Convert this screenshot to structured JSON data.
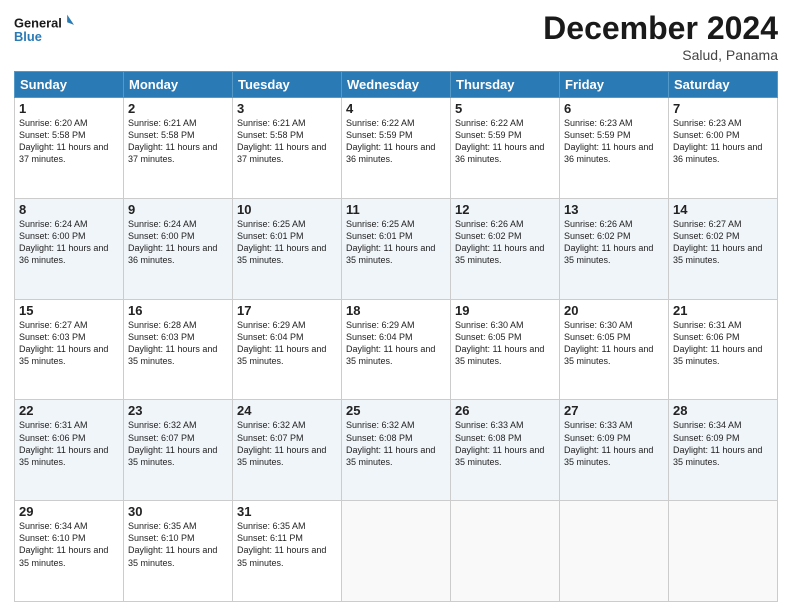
{
  "header": {
    "logo_line1": "General",
    "logo_line2": "Blue",
    "month": "December 2024",
    "location": "Salud, Panama"
  },
  "days_of_week": [
    "Sunday",
    "Monday",
    "Tuesday",
    "Wednesday",
    "Thursday",
    "Friday",
    "Saturday"
  ],
  "weeks": [
    [
      {
        "day": "1",
        "sunrise": "Sunrise: 6:20 AM",
        "sunset": "Sunset: 5:58 PM",
        "daylight": "Daylight: 11 hours and 37 minutes."
      },
      {
        "day": "2",
        "sunrise": "Sunrise: 6:21 AM",
        "sunset": "Sunset: 5:58 PM",
        "daylight": "Daylight: 11 hours and 37 minutes."
      },
      {
        "day": "3",
        "sunrise": "Sunrise: 6:21 AM",
        "sunset": "Sunset: 5:58 PM",
        "daylight": "Daylight: 11 hours and 37 minutes."
      },
      {
        "day": "4",
        "sunrise": "Sunrise: 6:22 AM",
        "sunset": "Sunset: 5:59 PM",
        "daylight": "Daylight: 11 hours and 36 minutes."
      },
      {
        "day": "5",
        "sunrise": "Sunrise: 6:22 AM",
        "sunset": "Sunset: 5:59 PM",
        "daylight": "Daylight: 11 hours and 36 minutes."
      },
      {
        "day": "6",
        "sunrise": "Sunrise: 6:23 AM",
        "sunset": "Sunset: 5:59 PM",
        "daylight": "Daylight: 11 hours and 36 minutes."
      },
      {
        "day": "7",
        "sunrise": "Sunrise: 6:23 AM",
        "sunset": "Sunset: 6:00 PM",
        "daylight": "Daylight: 11 hours and 36 minutes."
      }
    ],
    [
      {
        "day": "8",
        "sunrise": "Sunrise: 6:24 AM",
        "sunset": "Sunset: 6:00 PM",
        "daylight": "Daylight: 11 hours and 36 minutes."
      },
      {
        "day": "9",
        "sunrise": "Sunrise: 6:24 AM",
        "sunset": "Sunset: 6:00 PM",
        "daylight": "Daylight: 11 hours and 36 minutes."
      },
      {
        "day": "10",
        "sunrise": "Sunrise: 6:25 AM",
        "sunset": "Sunset: 6:01 PM",
        "daylight": "Daylight: 11 hours and 35 minutes."
      },
      {
        "day": "11",
        "sunrise": "Sunrise: 6:25 AM",
        "sunset": "Sunset: 6:01 PM",
        "daylight": "Daylight: 11 hours and 35 minutes."
      },
      {
        "day": "12",
        "sunrise": "Sunrise: 6:26 AM",
        "sunset": "Sunset: 6:02 PM",
        "daylight": "Daylight: 11 hours and 35 minutes."
      },
      {
        "day": "13",
        "sunrise": "Sunrise: 6:26 AM",
        "sunset": "Sunset: 6:02 PM",
        "daylight": "Daylight: 11 hours and 35 minutes."
      },
      {
        "day": "14",
        "sunrise": "Sunrise: 6:27 AM",
        "sunset": "Sunset: 6:02 PM",
        "daylight": "Daylight: 11 hours and 35 minutes."
      }
    ],
    [
      {
        "day": "15",
        "sunrise": "Sunrise: 6:27 AM",
        "sunset": "Sunset: 6:03 PM",
        "daylight": "Daylight: 11 hours and 35 minutes."
      },
      {
        "day": "16",
        "sunrise": "Sunrise: 6:28 AM",
        "sunset": "Sunset: 6:03 PM",
        "daylight": "Daylight: 11 hours and 35 minutes."
      },
      {
        "day": "17",
        "sunrise": "Sunrise: 6:29 AM",
        "sunset": "Sunset: 6:04 PM",
        "daylight": "Daylight: 11 hours and 35 minutes."
      },
      {
        "day": "18",
        "sunrise": "Sunrise: 6:29 AM",
        "sunset": "Sunset: 6:04 PM",
        "daylight": "Daylight: 11 hours and 35 minutes."
      },
      {
        "day": "19",
        "sunrise": "Sunrise: 6:30 AM",
        "sunset": "Sunset: 6:05 PM",
        "daylight": "Daylight: 11 hours and 35 minutes."
      },
      {
        "day": "20",
        "sunrise": "Sunrise: 6:30 AM",
        "sunset": "Sunset: 6:05 PM",
        "daylight": "Daylight: 11 hours and 35 minutes."
      },
      {
        "day": "21",
        "sunrise": "Sunrise: 6:31 AM",
        "sunset": "Sunset: 6:06 PM",
        "daylight": "Daylight: 11 hours and 35 minutes."
      }
    ],
    [
      {
        "day": "22",
        "sunrise": "Sunrise: 6:31 AM",
        "sunset": "Sunset: 6:06 PM",
        "daylight": "Daylight: 11 hours and 35 minutes."
      },
      {
        "day": "23",
        "sunrise": "Sunrise: 6:32 AM",
        "sunset": "Sunset: 6:07 PM",
        "daylight": "Daylight: 11 hours and 35 minutes."
      },
      {
        "day": "24",
        "sunrise": "Sunrise: 6:32 AM",
        "sunset": "Sunset: 6:07 PM",
        "daylight": "Daylight: 11 hours and 35 minutes."
      },
      {
        "day": "25",
        "sunrise": "Sunrise: 6:32 AM",
        "sunset": "Sunset: 6:08 PM",
        "daylight": "Daylight: 11 hours and 35 minutes."
      },
      {
        "day": "26",
        "sunrise": "Sunrise: 6:33 AM",
        "sunset": "Sunset: 6:08 PM",
        "daylight": "Daylight: 11 hours and 35 minutes."
      },
      {
        "day": "27",
        "sunrise": "Sunrise: 6:33 AM",
        "sunset": "Sunset: 6:09 PM",
        "daylight": "Daylight: 11 hours and 35 minutes."
      },
      {
        "day": "28",
        "sunrise": "Sunrise: 6:34 AM",
        "sunset": "Sunset: 6:09 PM",
        "daylight": "Daylight: 11 hours and 35 minutes."
      }
    ],
    [
      {
        "day": "29",
        "sunrise": "Sunrise: 6:34 AM",
        "sunset": "Sunset: 6:10 PM",
        "daylight": "Daylight: 11 hours and 35 minutes."
      },
      {
        "day": "30",
        "sunrise": "Sunrise: 6:35 AM",
        "sunset": "Sunset: 6:10 PM",
        "daylight": "Daylight: 11 hours and 35 minutes."
      },
      {
        "day": "31",
        "sunrise": "Sunrise: 6:35 AM",
        "sunset": "Sunset: 6:11 PM",
        "daylight": "Daylight: 11 hours and 35 minutes."
      },
      null,
      null,
      null,
      null
    ]
  ]
}
